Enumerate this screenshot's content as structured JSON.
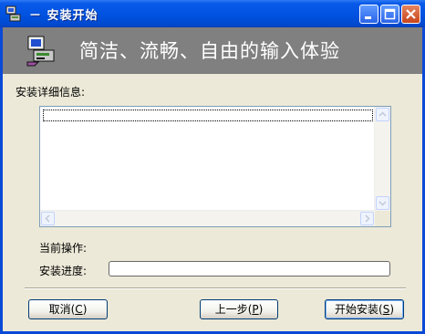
{
  "window": {
    "title": "－ 安装开始"
  },
  "banner": {
    "text": "简洁、流畅、自由的输入体验"
  },
  "details": {
    "label": "安装详细信息:",
    "rows": [
      ""
    ]
  },
  "status": {
    "current_op_label": "当前操作:",
    "progress_label": "安装进度:",
    "progress": 0
  },
  "buttons": {
    "cancel": {
      "label": "取消(",
      "key": "C",
      "suffix": ")"
    },
    "back": {
      "label": "上一步(",
      "key": "P",
      "suffix": ")"
    },
    "start": {
      "label": "开始安装(",
      "key": "S",
      "suffix": ")"
    }
  },
  "icons": {
    "app": "installer-icon",
    "banner": "installer-computer-icon",
    "min": "minimize-icon",
    "max": "maximize-icon",
    "close": "close-icon"
  },
  "colors": {
    "title_bar": "#0052e0",
    "banner_bg": "#808080",
    "window_bg": "#ece9d8"
  }
}
